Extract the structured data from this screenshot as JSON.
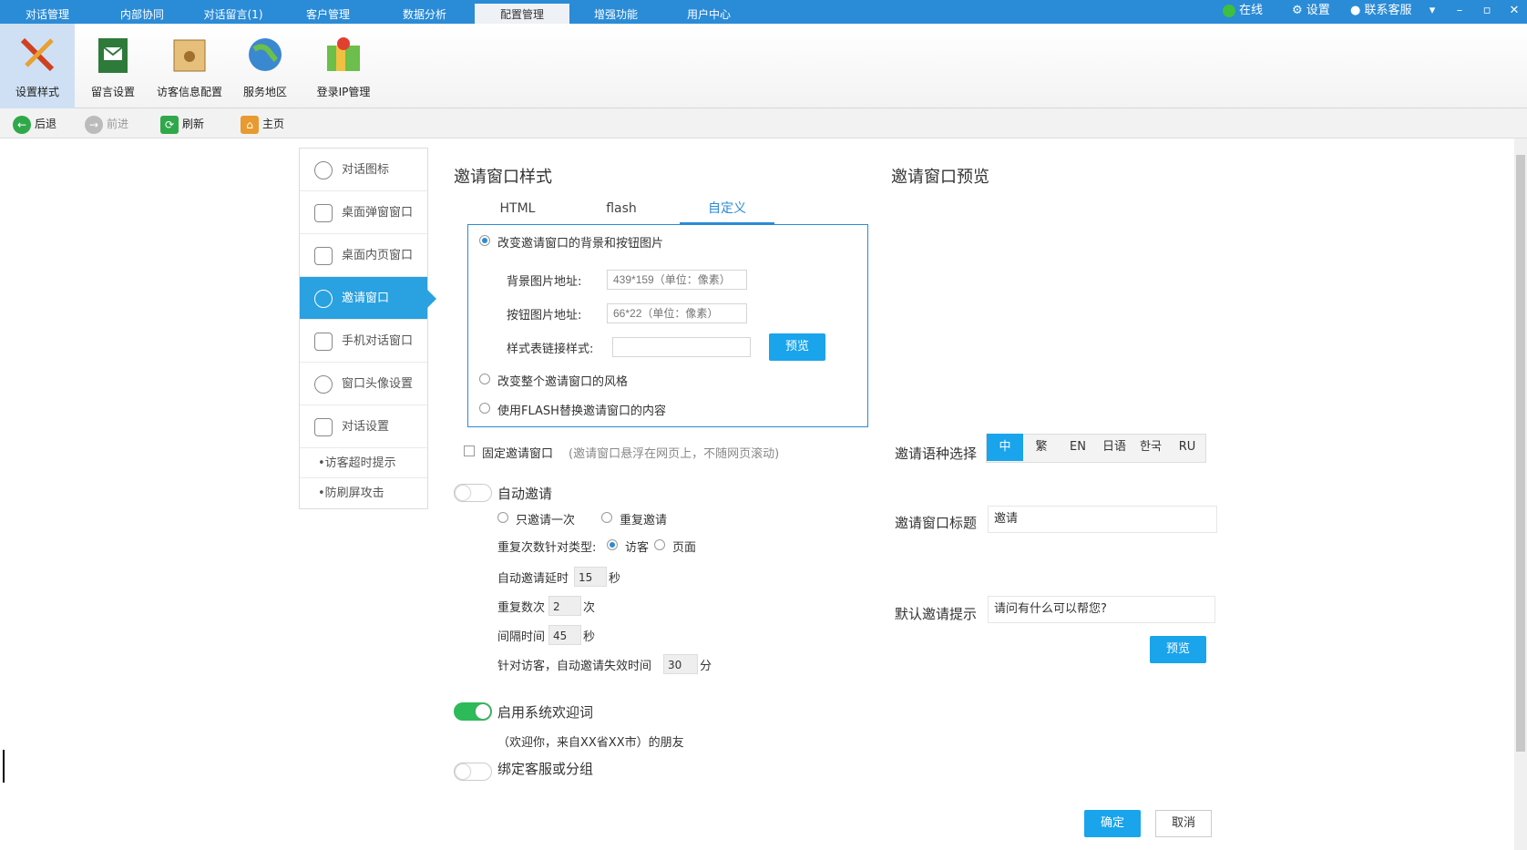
{
  "top_tabs": [
    "对话管理",
    "内部协同",
    "对话留言(1)",
    "客户管理",
    "数据分析",
    "配置管理",
    "增强功能",
    "用户中心"
  ],
  "top_right": {
    "online": "在线",
    "settings": "设置",
    "contact": "联系客服"
  },
  "ribbon": [
    "设置样式",
    "留言设置",
    "访客信息配置",
    "服务地区",
    "登录IP管理"
  ],
  "nav": {
    "back": "后退",
    "forward": "前进",
    "refresh": "刷新",
    "home": "主页"
  },
  "menu": [
    "对话图标",
    "桌面弹窗窗口",
    "桌面内页窗口",
    "邀请窗口",
    "手机对话窗口",
    "窗口头像设置",
    "对话设置"
  ],
  "menu_sub": [
    "•访客超时提示",
    "•防刷屏攻击"
  ],
  "left": {
    "title": "邀请窗口样式",
    "tabs": [
      "HTML",
      "flash",
      "自定义"
    ],
    "opt1": "改变邀请窗口的背景和按钮图片",
    "bg_label": "背景图片地址:",
    "bg_ph": "439*159（单位：像素）",
    "btn_label": "按钮图片地址:",
    "btn_ph": "66*22（单位：像素）",
    "css_label": "样式表链接样式:",
    "preview": "预览",
    "opt2": "改变整个邀请窗口的风格",
    "opt3": "使用FLASH替换邀请窗口的内容",
    "fixed": "固定邀请窗口",
    "fixed_note": "(邀请窗口悬浮在网页上，不随网页滚动)",
    "auto": "自动邀请",
    "once": "只邀请一次",
    "repeat": "重复邀请",
    "repeat_type": "重复次数针对类型:",
    "visitor": "访客",
    "page": "页面",
    "delay_label": "自动邀请延时",
    "delay": "15",
    "sec": "秒",
    "times_label": "重复数次",
    "times": "2",
    "times_unit": "次",
    "interval_label": "间隔时间",
    "interval": "45",
    "sec2": "秒",
    "expire_label": "针对访客，自动邀请失效时间",
    "expire": "30",
    "min": "分",
    "welcome": "启用系统欢迎词",
    "welcome_text": "（欢迎你，来自XX省XX市）的朋友",
    "bind": "绑定客服或分组"
  },
  "right": {
    "title": "邀请窗口预览",
    "lang_label": "邀请语种选择",
    "langs": [
      "中",
      "繁",
      "EN",
      "日语",
      "한국",
      "RU"
    ],
    "title_label": "邀请窗口标题",
    "title_value": "邀请",
    "tip_label": "默认邀请提示",
    "tip_value": "请问有什么可以帮您?",
    "preview": "预览"
  },
  "footer": {
    "ok": "确定",
    "cancel": "取消"
  },
  "colors": {
    "accent": "#19a4ec",
    "topbar": "#2a8bd6",
    "toggle_on": "#2cbb58"
  }
}
